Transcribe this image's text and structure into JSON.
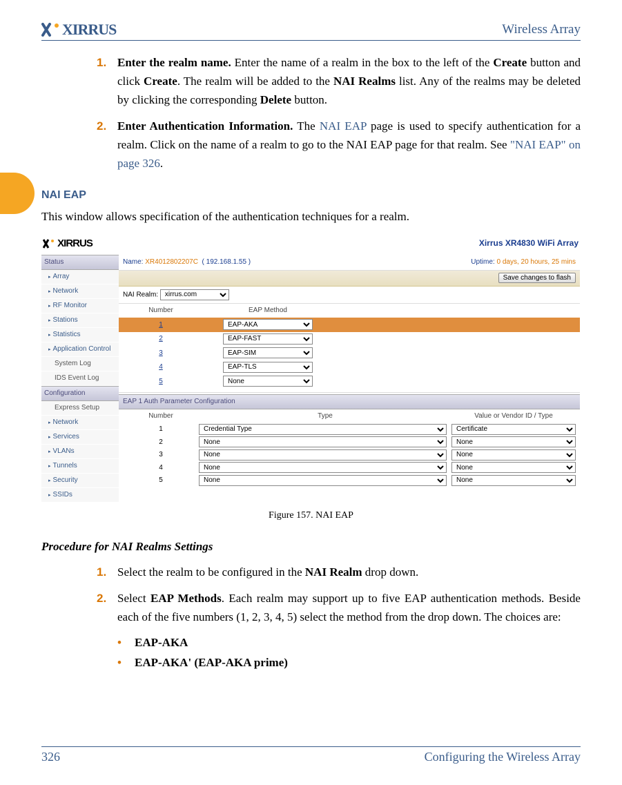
{
  "header": {
    "logo_text": "XIRRUS",
    "right_text": "Wireless Array"
  },
  "step1": {
    "num": "1.",
    "bold": "Enter the realm name.",
    "rest": " Enter the name of a realm in the box to the left of the ",
    "create1": "Create",
    "mid1": " button and click ",
    "create2": "Create",
    "mid2": ". The realm will be added to the ",
    "nai": "NAI Realms",
    "mid3": " list. Any of the realms may be deleted by clicking the corresponding ",
    "delete": "Delete",
    "end": " button."
  },
  "step2": {
    "num": "2.",
    "bold": "Enter Authentication Information.",
    "rest": " The ",
    "link1": "NAI EAP",
    "mid1": " page is used to specify authentication for a realm. Click on the name of a realm to go to the NAI EAP page for that realm. See ",
    "link2": "\"NAI EAP\" on page 326",
    "end": "."
  },
  "section": {
    "heading": "NAI EAP",
    "intro": "This window allows specification of the authentication techniques for a realm."
  },
  "screenshot": {
    "logo": "XIRRUS",
    "array_title": "Xirrus XR4830 WiFi Array",
    "name_label": "Name:",
    "name_val": "XR4012802207C",
    "ip": "( 192.168.1.55 )",
    "uptime_label": "Uptime:",
    "uptime_val": "0 days, 20 hours, 25 mins",
    "save_btn": "Save changes to flash",
    "realm_label": "NAI Realm:",
    "realm_val": "xirrus.com",
    "col_number": "Number",
    "col_eap": "EAP Method",
    "eap_rows": [
      {
        "n": "1",
        "method": "EAP-AKA",
        "hl": true
      },
      {
        "n": "2",
        "method": "EAP-FAST",
        "hl": false
      },
      {
        "n": "3",
        "method": "EAP-SIM",
        "hl": false
      },
      {
        "n": "4",
        "method": "EAP-TLS",
        "hl": false
      },
      {
        "n": "5",
        "method": "None",
        "hl": false
      }
    ],
    "param_head": "EAP 1 Auth Parameter Configuration",
    "auth_col_num": "Number",
    "auth_col_type": "Type",
    "auth_col_val": "Value or Vendor ID / Type",
    "auth_rows": [
      {
        "n": "1",
        "type": "Credential Type",
        "val": "Certificate"
      },
      {
        "n": "2",
        "type": "None",
        "val": "None"
      },
      {
        "n": "3",
        "type": "None",
        "val": "None"
      },
      {
        "n": "4",
        "type": "None",
        "val": "None"
      },
      {
        "n": "5",
        "type": "None",
        "val": "None"
      }
    ],
    "sidebar": {
      "status_head": "Status",
      "status_items": [
        "Array",
        "Network",
        "RF Monitor",
        "Stations",
        "Statistics",
        "Application Control"
      ],
      "status_plain": [
        "System Log",
        "IDS Event Log"
      ],
      "config_head": "Configuration",
      "config_plain": [
        "Express Setup"
      ],
      "config_items": [
        "Network",
        "Services",
        "VLANs",
        "Tunnels",
        "Security",
        "SSIDs"
      ]
    }
  },
  "figure_caption": "Figure 157. NAI EAP",
  "procedure_head": "Procedure for NAI Realms Settings",
  "proc1": {
    "num": "1.",
    "pre": "Select the realm to be configured in the ",
    "bold": "NAI Realm",
    "post": " drop down."
  },
  "proc2": {
    "num": "2.",
    "pre": "Select ",
    "bold": "EAP Methods",
    "post": ". Each realm may support up to five EAP authentication methods. Beside each of the five numbers (1, 2, 3, 4, 5) select the method from the drop down. The choices are:"
  },
  "bullets": {
    "b1": "EAP-AKA",
    "b2": "EAP-AKA' (EAP-AKA prime)"
  },
  "footer": {
    "page": "326",
    "title": "Configuring the Wireless Array"
  }
}
